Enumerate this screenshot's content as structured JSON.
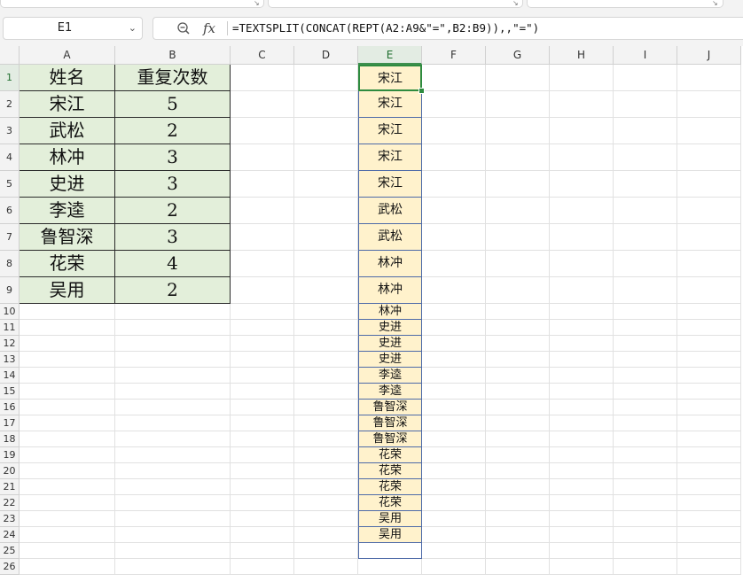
{
  "name_box": {
    "value": "E1"
  },
  "formula": {
    "text": "=TEXTSPLIT(CONCAT(REPT(A2:A9&\"=\",B2:B9)),,\"=\")"
  },
  "ribbon": {
    "launcher_glyph": "↘"
  },
  "columns": [
    "A",
    "B",
    "C",
    "D",
    "E",
    "F",
    "G",
    "H",
    "I",
    "J"
  ],
  "active_column": "E",
  "active_row": 1,
  "rows": [
    1,
    2,
    3,
    4,
    5,
    6,
    7,
    8,
    9,
    10,
    11,
    12,
    13,
    14,
    15,
    16,
    17,
    18,
    19,
    20,
    21,
    22,
    23,
    24,
    25,
    26
  ],
  "table": {
    "headers": [
      "姓名",
      "重复次数"
    ],
    "rows": [
      [
        "宋江",
        "5"
      ],
      [
        "武松",
        "2"
      ],
      [
        "林冲",
        "3"
      ],
      [
        "史进",
        "3"
      ],
      [
        "李逵",
        "2"
      ],
      [
        "鲁智深",
        "3"
      ],
      [
        "花荣",
        "4"
      ],
      [
        "吴用",
        "2"
      ]
    ]
  },
  "column_e": [
    "宋江",
    "宋江",
    "宋江",
    "宋江",
    "宋江",
    "武松",
    "武松",
    "林冲",
    "林冲",
    "林冲",
    "史进",
    "史进",
    "史进",
    "李逵",
    "李逵",
    "鲁智深",
    "鲁智深",
    "鲁智深",
    "花荣",
    "花荣",
    "花荣",
    "花荣",
    "吴用",
    "吴用"
  ],
  "colors": {
    "table_fill": "#e3efda",
    "spill_fill": "#fff2cc",
    "spill_border": "#4d6aa8",
    "selection": "#2e8b3f"
  }
}
